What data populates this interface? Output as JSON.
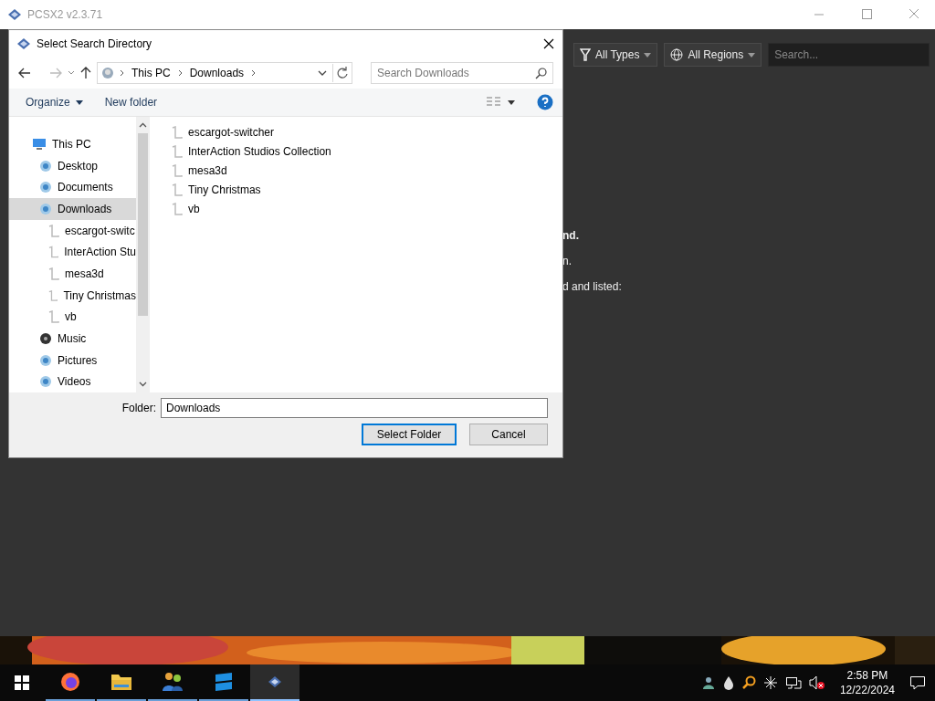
{
  "app_window": {
    "title": "PCSX2 v2.3.71",
    "filters": [
      {
        "label": "All Types",
        "kind": "type"
      },
      {
        "label": "All Regions",
        "kind": "region"
      }
    ],
    "search": {
      "placeholder": "Search..."
    },
    "message_fragments": [
      {
        "text": "nd.",
        "bold": true
      },
      {
        "text": "n.",
        "bold": false
      },
      {
        "text": "d and listed:",
        "bold": false
      }
    ]
  },
  "dialog": {
    "title": "Select Search Directory",
    "breadcrumb": [
      "This PC",
      "Downloads"
    ],
    "search": {
      "placeholder": "Search Downloads"
    },
    "commands": [
      {
        "label": "Organize",
        "dropdown": true
      },
      {
        "label": "New folder",
        "dropdown": false
      }
    ],
    "nav_tree": [
      {
        "label": "This PC",
        "kind": "computer",
        "selected": false,
        "children": [
          {
            "label": "Desktop",
            "kind": "library",
            "selected": false
          },
          {
            "label": "Documents",
            "kind": "library",
            "selected": false
          },
          {
            "label": "Downloads",
            "kind": "library",
            "selected": true,
            "children": [
              {
                "label": "escargot-switc",
                "kind": "folder",
                "selected": false
              },
              {
                "label": "InterAction Stu",
                "kind": "folder",
                "selected": false
              },
              {
                "label": "mesa3d",
                "kind": "folder",
                "selected": false
              },
              {
                "label": "Tiny Christmas",
                "kind": "folder",
                "selected": false
              },
              {
                "label": "vb",
                "kind": "folder",
                "selected": false
              }
            ]
          },
          {
            "label": "Music",
            "kind": "music",
            "selected": false
          },
          {
            "label": "Pictures",
            "kind": "library",
            "selected": false
          },
          {
            "label": "Videos",
            "kind": "library",
            "selected": false
          }
        ]
      }
    ],
    "files": [
      "escargot-switcher",
      "InterAction Studios Collection",
      "mesa3d",
      "Tiny Christmas",
      "vb"
    ],
    "folder_label": "Folder:",
    "folder_value": "Downloads",
    "buttons": [
      {
        "label": "Select Folder",
        "default": true
      },
      {
        "label": "Cancel",
        "default": false
      }
    ]
  },
  "taskbar": {
    "apps": [
      {
        "kind": "browser",
        "selected": false
      },
      {
        "kind": "files",
        "selected": false
      },
      {
        "kind": "people",
        "selected": false
      },
      {
        "kind": "blocks",
        "selected": false
      },
      {
        "kind": "emulator",
        "selected": true
      }
    ],
    "time": "2:58 PM",
    "date": "12/22/2024"
  }
}
